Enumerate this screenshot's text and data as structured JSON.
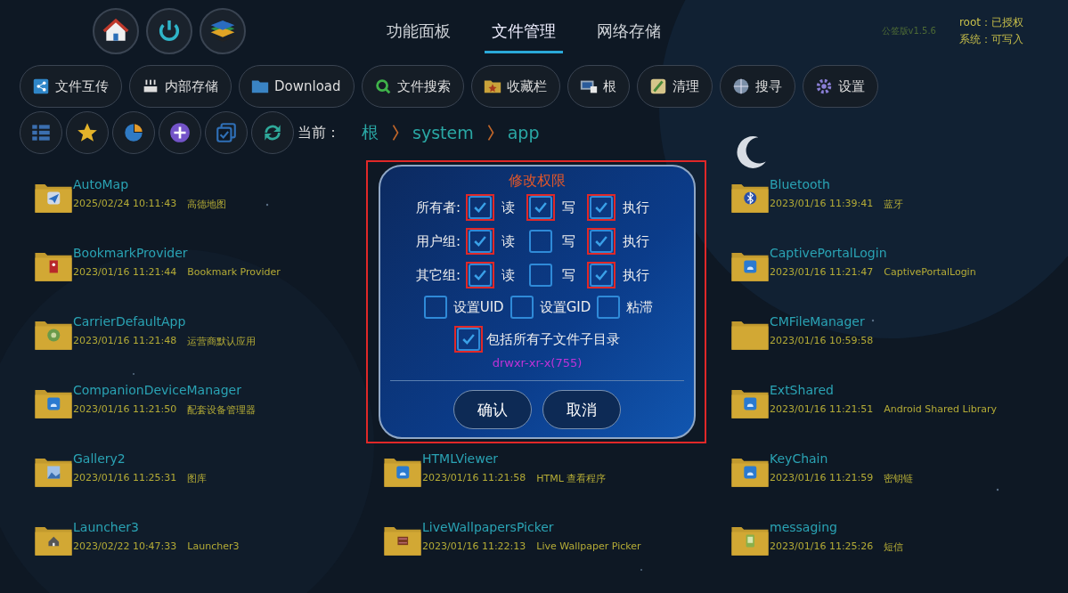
{
  "top_buttons": [
    {
      "kind": "home"
    },
    {
      "kind": "power"
    },
    {
      "kind": "layers"
    }
  ],
  "tabs": [
    {
      "label": "功能面板",
      "selected": false
    },
    {
      "label": "文件管理",
      "selected": true
    },
    {
      "label": "网络存储",
      "selected": false
    }
  ],
  "version": "公签版v1.5.6",
  "status": [
    "root：已授权",
    "系统：可写入"
  ],
  "shortcuts": [
    {
      "label": "文件互传",
      "kind": "share"
    },
    {
      "label": "内部存储",
      "kind": "storage"
    },
    {
      "label": "Download",
      "kind": "folder"
    },
    {
      "label": "文件搜索",
      "kind": "search"
    },
    {
      "label": "收藏栏",
      "kind": "favfolder"
    },
    {
      "label": "根",
      "kind": "root"
    },
    {
      "label": "清理",
      "kind": "clean"
    },
    {
      "label": "搜寻",
      "kind": "find"
    },
    {
      "label": "设置",
      "kind": "settings"
    }
  ],
  "tools": [
    {
      "kind": "list"
    },
    {
      "kind": "star"
    },
    {
      "kind": "pie"
    },
    {
      "kind": "add"
    },
    {
      "kind": "select"
    },
    {
      "kind": "refresh"
    }
  ],
  "breadcrumb": {
    "label": "当前：",
    "parts": [
      "根",
      "system",
      "app"
    ]
  },
  "file_columns": [
    [
      {
        "name": "AutoMap",
        "date": "2025/02/24 10:11:43",
        "desc": "高德地图",
        "kind": "plane"
      },
      {
        "name": "BookmarkProvider",
        "date": "2023/01/16 11:21:44",
        "desc": "Bookmark Provider",
        "kind": "bookmark"
      },
      {
        "name": "CarrierDefaultApp",
        "date": "2023/01/16 11:21:48",
        "desc": "运营商默认应用",
        "kind": "gear"
      },
      {
        "name": "CompanionDeviceManager",
        "date": "2023/01/16 11:21:50",
        "desc": "配套设备管理器",
        "kind": "android"
      },
      {
        "name": "Gallery2",
        "date": "2023/01/16 11:25:31",
        "desc": "图库"
      },
      {
        "name": "Launcher3",
        "date": "2023/02/22 10:47:33",
        "desc": "Launcher3",
        "kind": "house"
      }
    ],
    [
      {
        "name": "HTMLViewer",
        "date": "2023/01/16 11:21:58",
        "desc": "HTML 查看程序",
        "kind": "android"
      },
      {
        "name": "LiveWallpapersPicker",
        "date": "2023/01/16 11:22:13",
        "desc": "Live Wallpaper Picker",
        "kind": "film"
      }
    ],
    [
      {
        "name": "Bluetooth",
        "date": "2023/01/16 11:39:41",
        "desc": "蓝牙",
        "kind": "bluetooth"
      },
      {
        "name": "CaptivePortalLogin",
        "date": "2023/01/16 11:21:47",
        "desc": "CaptivePortalLogin",
        "kind": "android"
      },
      {
        "name": "CMFileManager",
        "date": "2023/01/16 10:59:58",
        "kind": "plain"
      },
      {
        "name": "ExtShared",
        "date": "2023/01/16 11:21:51",
        "desc": "Android Shared Library",
        "kind": "android"
      },
      {
        "name": "KeyChain",
        "date": "2023/01/16 11:21:59",
        "desc": "密钥链",
        "kind": "android"
      },
      {
        "name": "messaging",
        "date": "2023/01/16 11:25:26",
        "desc": "短信",
        "kind": "message"
      }
    ]
  ],
  "dialog": {
    "title": "修改权限",
    "highlighted": true,
    "rows": [
      {
        "label": "所有者:",
        "perms": [
          {
            "label": "读",
            "checked": true,
            "highlighted": true
          },
          {
            "label": "写",
            "checked": true,
            "highlighted": true
          },
          {
            "label": "执行",
            "checked": true,
            "highlighted": true
          }
        ]
      },
      {
        "label": "用户组:",
        "perms": [
          {
            "label": "读",
            "checked": true,
            "highlighted": true
          },
          {
            "label": "写",
            "checked": false,
            "highlighted": false
          },
          {
            "label": "执行",
            "checked": true,
            "highlighted": true
          }
        ]
      },
      {
        "label": "其它组:",
        "perms": [
          {
            "label": "读",
            "checked": true,
            "highlighted": true
          },
          {
            "label": "写",
            "checked": false,
            "highlighted": false
          },
          {
            "label": "执行",
            "checked": true,
            "highlighted": true
          }
        ]
      }
    ],
    "specials": [
      {
        "label": "设置UID",
        "checked": false
      },
      {
        "label": "设置GID",
        "checked": false
      },
      {
        "label": "粘滞",
        "checked": false
      }
    ],
    "recursive": {
      "label": "包括所有子文件子目录",
      "checked": true,
      "highlighted": true
    },
    "mode": "drwxr-xr-x(755)",
    "buttons": [
      "确认",
      "取消"
    ]
  }
}
